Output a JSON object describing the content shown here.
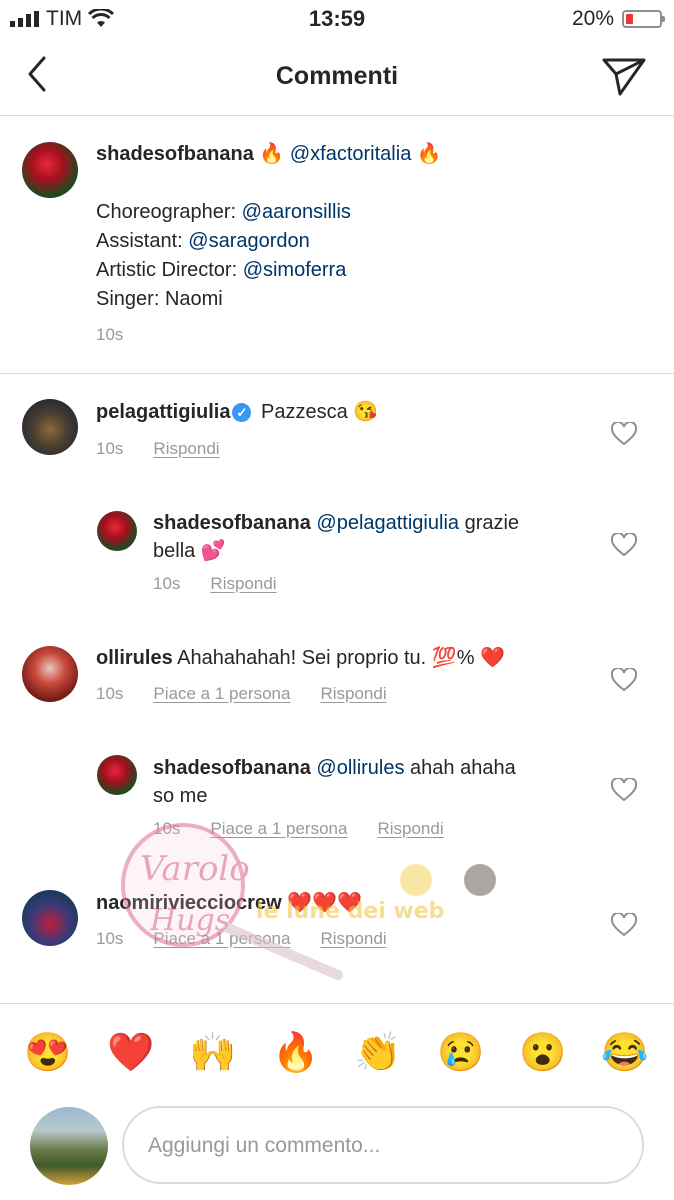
{
  "status_bar": {
    "carrier": "TIM",
    "time": "13:59",
    "battery": "20%",
    "battery_level": 0.2
  },
  "header": {
    "title": "Commenti"
  },
  "caption": {
    "username": "shadesofbanana",
    "fire_emoji": "🔥",
    "mention": "@xfactoritalia",
    "lines": [
      {
        "label": "Choreographer: ",
        "value": "@aaronsillis"
      },
      {
        "label": "Assistant: ",
        "value": "@saragordon"
      },
      {
        "label": "Artistic Director: ",
        "value": "@simoferra"
      },
      {
        "label": "Singer: ",
        "value": "Naomi"
      }
    ],
    "time": "10s"
  },
  "comments": [
    {
      "username": "pelagattigiulia",
      "verified_mark": "✓",
      "text": "Pazzesca",
      "emoji": "😘",
      "time": "10s",
      "reply": "Rispondi"
    },
    {
      "username": "shadesofbanana",
      "mention": "@pelagattigiulia",
      "text": " grazie",
      "text2": "bella",
      "emoji": "💕",
      "time": "10s",
      "reply": "Rispondi"
    },
    {
      "username": "ollirules",
      "text": "Ahahahahah! Sei proprio tu.",
      "emoji": "💯%",
      "emoji2": "❤️",
      "time": "10s",
      "likes": "Piace a 1 persona",
      "reply": "Rispondi"
    },
    {
      "username": "shadesofbanana",
      "mention": "@ollirules",
      "text": " ahah ahaha",
      "text2": "so me",
      "time": "10s",
      "likes": "Piace a 1 persona",
      "reply": "Rispondi"
    },
    {
      "username": "naomiriviecciocrew",
      "emoji": "❤️❤️❤️",
      "time": "10s",
      "likes": "Piace a 1 persona",
      "reply": "Rispondi"
    }
  ],
  "emoji_bar": [
    "😍",
    "❤️",
    "🙌",
    "🔥",
    "👏",
    "😢",
    "😮",
    "😂"
  ],
  "comment_input": {
    "placeholder": "Aggiungi un commento..."
  },
  "watermark": {
    "line1": "Varolo",
    "line2": "Hugs",
    "line3": "le lune dei web"
  },
  "colors": {
    "mention": "#003569",
    "meta": "#999999",
    "divider": "#dbdbdb",
    "verified": "#3897f0",
    "battery": "#ee3333"
  }
}
